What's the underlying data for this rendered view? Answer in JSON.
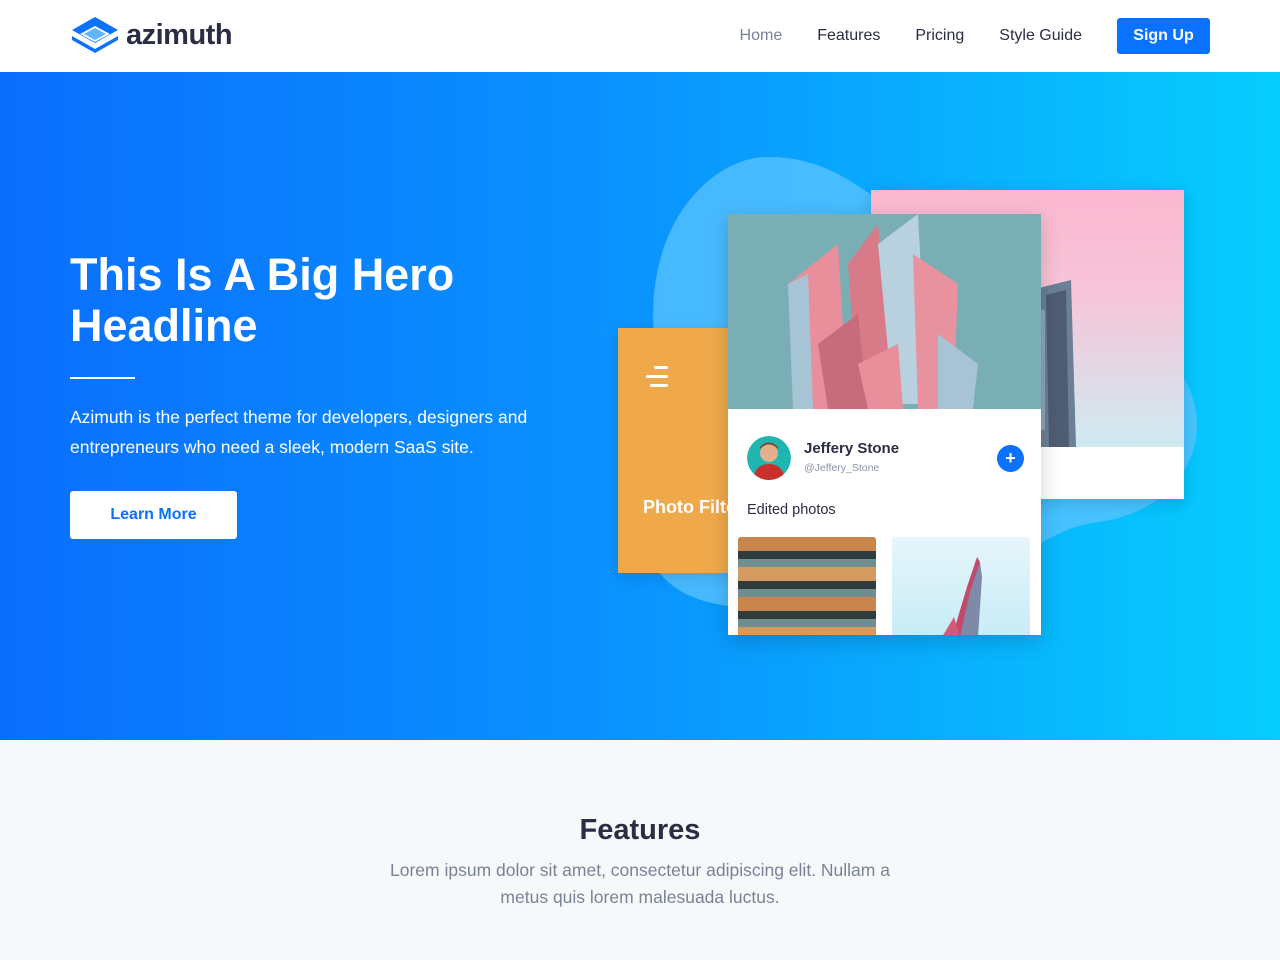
{
  "brand": {
    "name": "azimuth"
  },
  "nav": {
    "links": [
      {
        "label": "Home"
      },
      {
        "label": "Features"
      },
      {
        "label": "Pricing"
      },
      {
        "label": "Style Guide"
      }
    ],
    "signup_label": "Sign Up"
  },
  "hero": {
    "headline": "This Is A Big Hero Headline",
    "description": "Azimuth is the perfect theme for developers, designers and entrepreneurs who need a sleek, modern SaaS site.",
    "cta_label": "Learn More"
  },
  "mockup": {
    "orange_card_text": "Photo Filter Orange",
    "profile": {
      "name": "Jeffery Stone",
      "handle": "@Jeffery_Stone"
    },
    "plus_label": "+",
    "edited_label": "Edited photos"
  },
  "features": {
    "title": "Features",
    "description": "Lorem ipsum dolor sit amet, consectetur adipiscing elit. Nullam a metus quis lorem malesuada luctus."
  },
  "colors": {
    "primary": "#0a72ff",
    "hero_gradient_start": "#0a6efd",
    "hero_gradient_end": "#06cdfd",
    "orange_card": "#f0a94a",
    "text_dark": "#2b2d42",
    "text_muted": "#7a8298"
  },
  "icons": {
    "logo": "azimuth-logo-icon",
    "menu": "menu-lines-icon",
    "plus": "plus-icon"
  }
}
